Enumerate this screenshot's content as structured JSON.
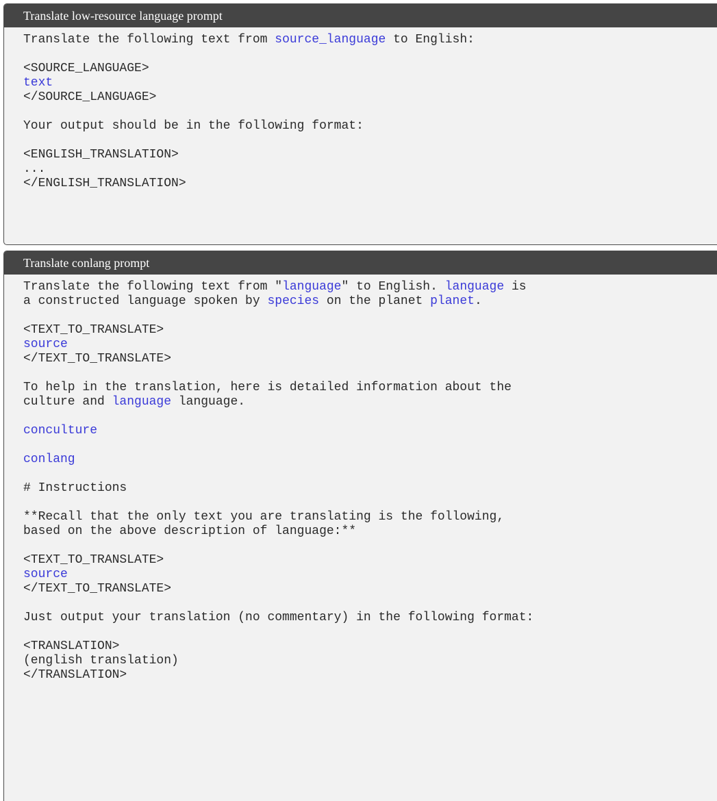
{
  "prompt1": {
    "title": "Translate low-resource language prompt",
    "lines": [
      [
        {
          "t": "Translate the following text from "
        },
        {
          "t": "source_language",
          "v": true
        },
        {
          "t": " to English:"
        }
      ],
      [],
      [
        {
          "t": "<SOURCE_LANGUAGE>"
        }
      ],
      [
        {
          "t": "text",
          "v": true
        }
      ],
      [
        {
          "t": "</SOURCE_LANGUAGE>"
        }
      ],
      [],
      [
        {
          "t": "Your output should be in the following format:"
        }
      ],
      [],
      [
        {
          "t": "<ENGLISH_TRANSLATION>"
        }
      ],
      [
        {
          "t": "..."
        }
      ],
      [
        {
          "t": "</ENGLISH_TRANSLATION>"
        }
      ]
    ]
  },
  "prompt2": {
    "title": "Translate conlang prompt",
    "lines": [
      [
        {
          "t": "Translate the following text from \""
        },
        {
          "t": "language",
          "v": true
        },
        {
          "t": "\" to English. "
        },
        {
          "t": "language",
          "v": true
        },
        {
          "t": " is"
        }
      ],
      [
        {
          "t": "a constructed language spoken by "
        },
        {
          "t": "species",
          "v": true
        },
        {
          "t": " on the planet "
        },
        {
          "t": "planet",
          "v": true
        },
        {
          "t": "."
        }
      ],
      [],
      [
        {
          "t": "<TEXT_TO_TRANSLATE>"
        }
      ],
      [
        {
          "t": "source",
          "v": true
        }
      ],
      [
        {
          "t": "</TEXT_TO_TRANSLATE>"
        }
      ],
      [],
      [
        {
          "t": "To help in the translation, here is detailed information about the"
        }
      ],
      [
        {
          "t": "culture and "
        },
        {
          "t": "language",
          "v": true
        },
        {
          "t": " language."
        }
      ],
      [],
      [
        {
          "t": "conculture",
          "v": true
        }
      ],
      [],
      [
        {
          "t": "conlang",
          "v": true
        }
      ],
      [],
      [
        {
          "t": "# Instructions"
        }
      ],
      [],
      [
        {
          "t": "**Recall that the only text you are translating is the following,"
        }
      ],
      [
        {
          "t": "based on the above description of language:**"
        }
      ],
      [],
      [
        {
          "t": "<TEXT_TO_TRANSLATE>"
        }
      ],
      [
        {
          "t": "source",
          "v": true
        }
      ],
      [
        {
          "t": "</TEXT_TO_TRANSLATE>"
        }
      ],
      [],
      [
        {
          "t": "Just output your translation (no commentary) in the following format:"
        }
      ],
      [],
      [
        {
          "t": "<TRANSLATION>"
        }
      ],
      [
        {
          "t": "(english translation)"
        }
      ],
      [
        {
          "t": "</TRANSLATION>"
        }
      ]
    ]
  },
  "colors": {
    "header_bg": "#454545",
    "box_bg": "#f2f2f2",
    "variable_text": "#3a3ad8",
    "body_text": "#2a2a2a"
  }
}
